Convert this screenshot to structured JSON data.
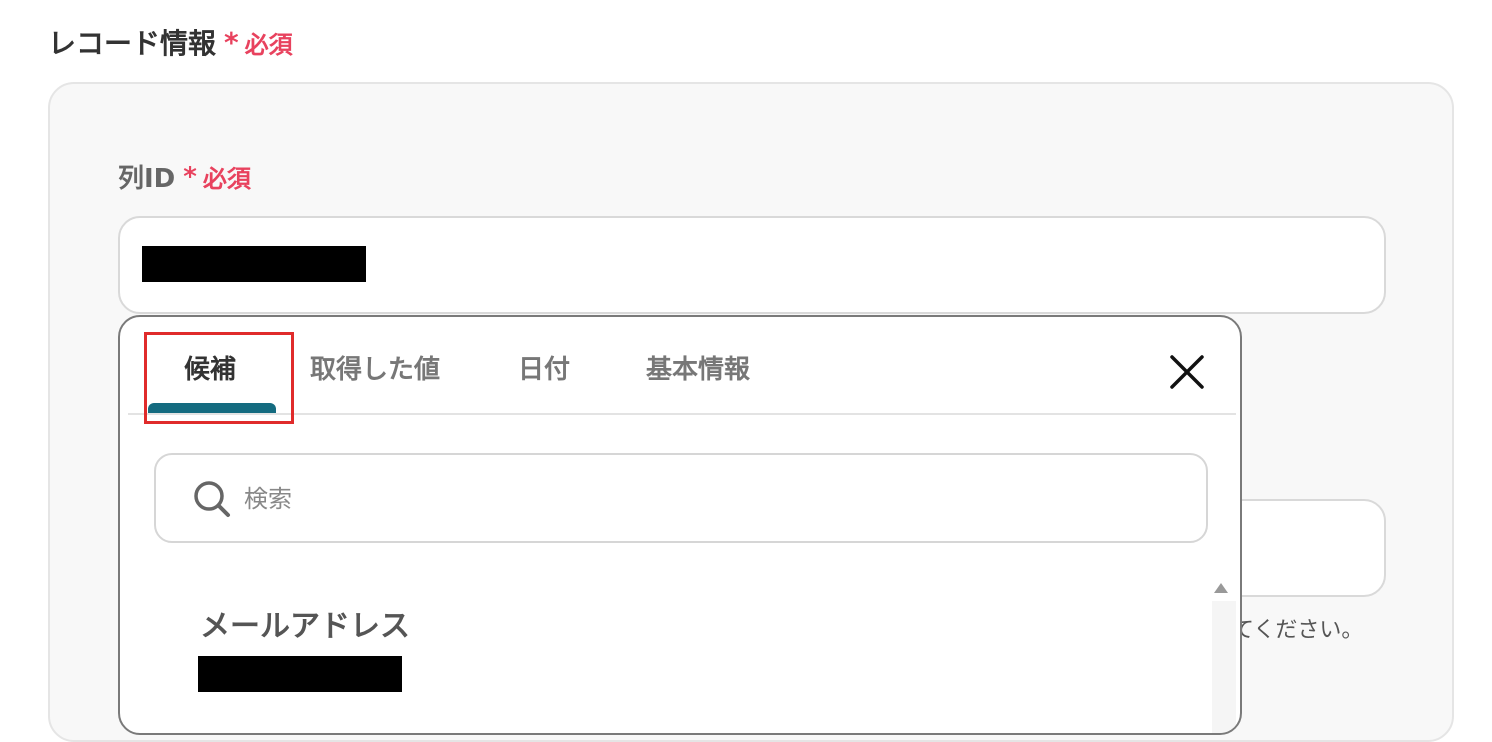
{
  "section": {
    "title": "レコード情報",
    "required_star": "*",
    "required_text": "必須"
  },
  "field": {
    "label": "列ID",
    "required_star": "*",
    "required_text": "必須"
  },
  "hint": "てください。",
  "popup": {
    "tabs": [
      {
        "label": "候補",
        "active": true
      },
      {
        "label": "取得した値",
        "active": false
      },
      {
        "label": "日付",
        "active": false
      },
      {
        "label": "基本情報",
        "active": false
      }
    ],
    "search": {
      "placeholder": "検索"
    },
    "items": [
      {
        "title": "メールアドレス"
      }
    ]
  },
  "colors": {
    "required": "#e8425e",
    "tab_underline": "#146b80",
    "highlight": "#e02b2b"
  }
}
